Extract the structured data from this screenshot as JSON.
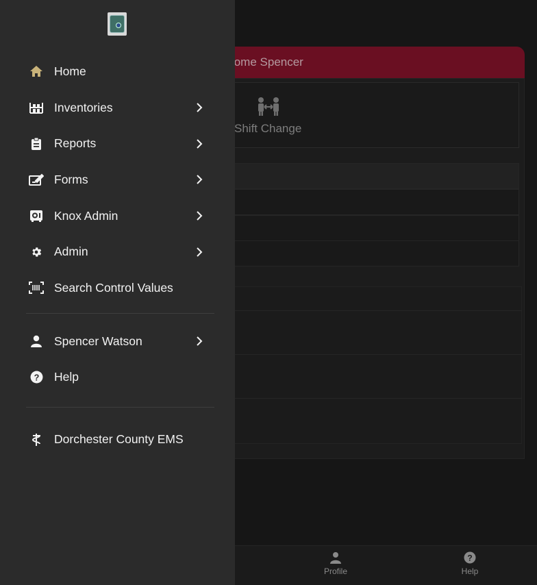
{
  "background": {
    "welcome_text": "elcome Spencer",
    "shift_change_label": "Shift Change",
    "bottom_nav": {
      "profile_label": "Profile",
      "help_label": "Help"
    }
  },
  "drawer": {
    "logo_icon": "agency-seal-icon",
    "menu_items": [
      {
        "label": "Home",
        "icon": "home-icon",
        "chevron": false
      },
      {
        "label": "Inventories",
        "icon": "inventory-icon",
        "chevron": true
      },
      {
        "label": "Reports",
        "icon": "clipboard-icon",
        "chevron": true
      },
      {
        "label": "Forms",
        "icon": "form-edit-icon",
        "chevron": true
      },
      {
        "label": "Knox Admin",
        "icon": "safe-icon",
        "chevron": true
      },
      {
        "label": "Admin",
        "icon": "gear-icon",
        "chevron": true
      },
      {
        "label": "Search Control Values",
        "icon": "barcode-scan-icon",
        "chevron": false
      }
    ],
    "user_items": [
      {
        "label": "Spencer Watson",
        "icon": "person-icon",
        "chevron": true
      },
      {
        "label": "Help",
        "icon": "help-circle-icon",
        "chevron": false
      }
    ],
    "org_items": [
      {
        "label": "Dorchester County EMS",
        "icon": "caduceus-icon",
        "chevron": false
      }
    ]
  },
  "colors": {
    "drawer_bg": "#2b2b2b",
    "accent_home": "#c9b37a",
    "welcome_bar": "#6a0f22"
  }
}
